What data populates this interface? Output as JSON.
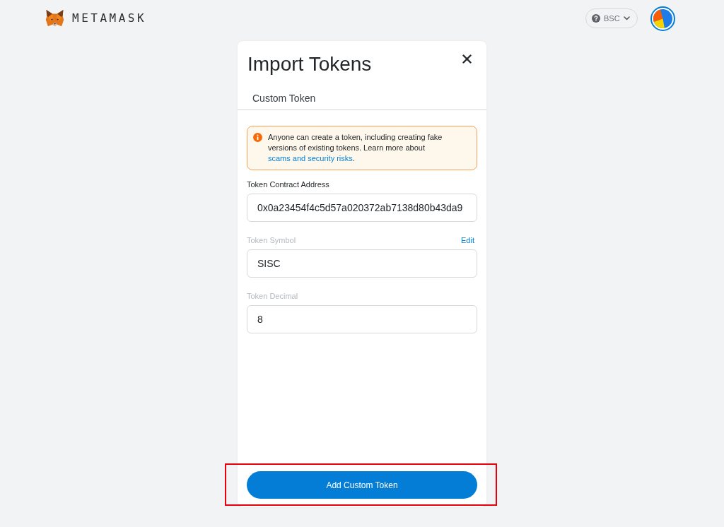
{
  "header": {
    "logo_text": "METAMASK",
    "network": {
      "label": "BSC"
    }
  },
  "dialog": {
    "title": "Import Tokens",
    "tabs": [
      {
        "label": "Custom Token"
      }
    ],
    "warning": {
      "text": "Anyone can create a token, including creating fake versions of existing tokens. Learn more about",
      "link": "scams and security risks",
      "text_after": "."
    },
    "fields": [
      {
        "label": "Token Contract Address",
        "value": "0x0a23454f4c5d57a020372ab7138d80b43da9",
        "disabled": false
      },
      {
        "label": "Token Symbol",
        "value": "SISC",
        "disabled": true,
        "action": "Edit"
      },
      {
        "label": "Token Decimal",
        "value": "8",
        "disabled": true
      }
    ],
    "add_button": {
      "label": "Add Custom Token",
      "highlighted": true
    }
  }
}
